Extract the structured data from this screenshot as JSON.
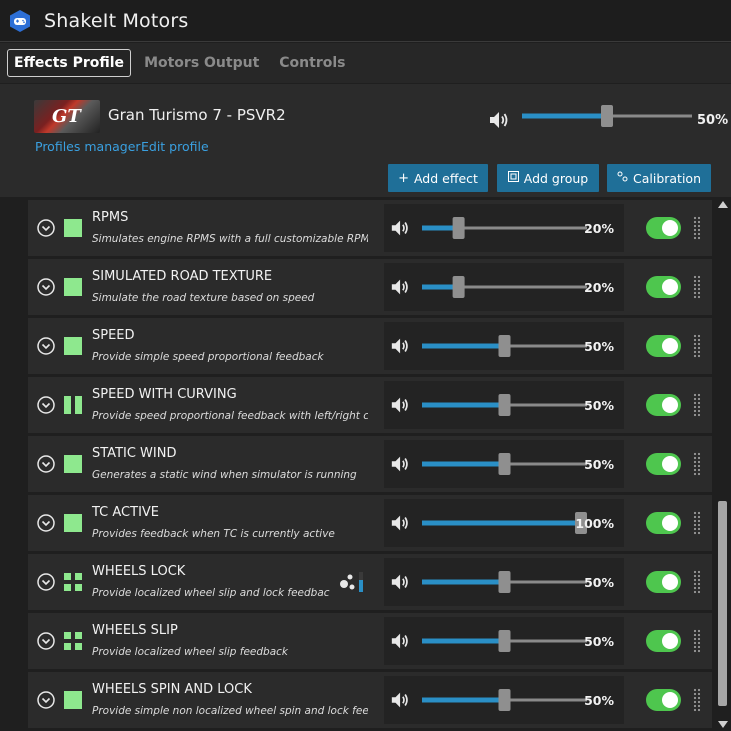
{
  "app": {
    "title": "ShakeIt Motors"
  },
  "tabs": [
    {
      "label": "Effects Profile",
      "active": true
    },
    {
      "label": "Motors Output",
      "active": false
    },
    {
      "label": "Controls",
      "active": false
    }
  ],
  "profile": {
    "game_title": "Gran Turismo 7 - PSVR2",
    "thumbnail_text": "GT",
    "links": {
      "profiles_manager": "Profiles manager",
      "edit_profile": "Edit profile"
    },
    "master_volume": {
      "value": 50,
      "label": "50%"
    }
  },
  "toolbar": {
    "add_effect": "Add effect",
    "add_group": "Add group",
    "calibration": "Calibration"
  },
  "colors": {
    "accent": "#1f6f98",
    "slider_fill": "#2a8fc6",
    "toggle_on": "#4ec64e",
    "effect_green": "#8ee88e",
    "link": "#3aa0e0"
  },
  "effects": [
    {
      "name": "RPMS",
      "description": "Simulates engine RPMS with a full customizable RPM,",
      "icon": "single-square-icon",
      "volume": 20,
      "volume_label": "20%",
      "enabled": true
    },
    {
      "name": "SIMULATED ROAD TEXTURE",
      "description": "Simulate the road texture based on speed",
      "icon": "single-square-icon",
      "volume": 20,
      "volume_label": "20%",
      "enabled": true
    },
    {
      "name": "SPEED",
      "description": "Provide simple speed proportional feedback",
      "icon": "single-square-icon",
      "volume": 50,
      "volume_label": "50%",
      "enabled": true
    },
    {
      "name": "SPEED WITH CURVING",
      "description": "Provide speed proportional feedback with left/right cu",
      "icon": "two-bars-icon",
      "volume": 50,
      "volume_label": "50%",
      "enabled": true
    },
    {
      "name": "STATIC WIND",
      "description": "Generates a static wind when simulator is running",
      "icon": "single-square-icon",
      "volume": 50,
      "volume_label": "50%",
      "enabled": true
    },
    {
      "name": "TC ACTIVE",
      "description": "Provides feedback when TC is currently active",
      "icon": "single-square-icon",
      "volume": 100,
      "volume_label": "100%",
      "enabled": true
    },
    {
      "name": "WHEELS LOCK",
      "description": "Provide localized wheel slip and lock feedbac",
      "icon": "four-squares-icon",
      "volume": 50,
      "volume_label": "50%",
      "enabled": true,
      "extra_icon": "signal-level-icon"
    },
    {
      "name": "WHEELS SLIP",
      "description": "Provide localized wheel slip feedback",
      "icon": "four-squares-icon",
      "volume": 50,
      "volume_label": "50%",
      "enabled": true
    },
    {
      "name": "WHEELS SPIN AND LOCK",
      "description": "Provide simple non localized wheel spin and lock feec",
      "icon": "single-square-icon",
      "volume": 50,
      "volume_label": "50%",
      "enabled": true
    }
  ]
}
